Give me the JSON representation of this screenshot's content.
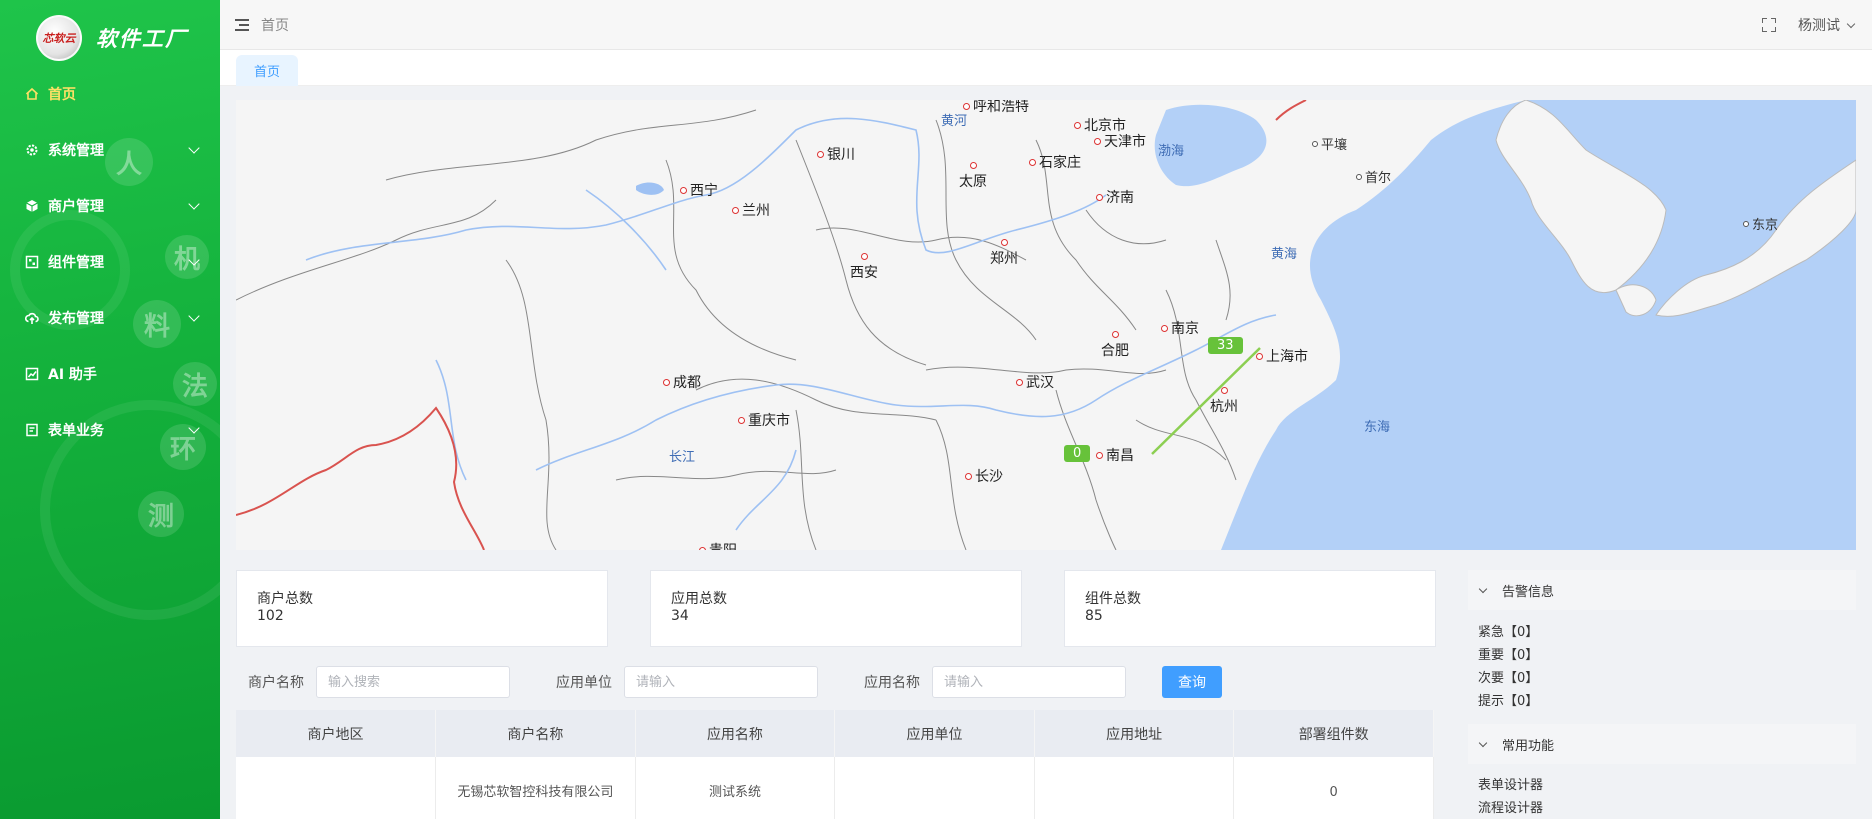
{
  "brand": {
    "name": "软件工厂",
    "logo_text": "芯软云"
  },
  "sidebar": {
    "items": [
      {
        "label": "首页",
        "icon": "home-icon",
        "active": true
      },
      {
        "label": "系统管理",
        "icon": "gear-icon",
        "expandable": true
      },
      {
        "label": "商户管理",
        "icon": "cube-icon",
        "expandable": true
      },
      {
        "label": "组件管理",
        "icon": "component-icon",
        "expandable": true
      },
      {
        "label": "发布管理",
        "icon": "cloud-upload-icon",
        "expandable": true
      },
      {
        "label": "AI 助手",
        "icon": "chart-icon"
      },
      {
        "label": "表单业务",
        "icon": "form-icon",
        "expandable": true
      }
    ],
    "decor_chars": [
      "人",
      "机",
      "料",
      "法",
      "环",
      "测"
    ]
  },
  "header": {
    "breadcrumb": "首页",
    "user": "杨测试"
  },
  "tabs": [
    {
      "label": "首页",
      "active": true
    }
  ],
  "map": {
    "cities": [
      "呼和浩特",
      "北京市",
      "天津市",
      "银川",
      "石家庄",
      "太原",
      "西宁",
      "兰州",
      "济南",
      "西安",
      "郑州",
      "南京",
      "合肥",
      "上海市",
      "成都",
      "武汉",
      "重庆市",
      "杭州",
      "南昌",
      "长沙",
      "贵阳",
      "平壤",
      "首尔",
      "东京"
    ],
    "water_labels": [
      "黄河",
      "渤海",
      "黄海",
      "东海",
      "长江"
    ],
    "markers": [
      {
        "label": "33"
      },
      {
        "label": "0"
      }
    ],
    "colors": {
      "land": "#f5f5f5",
      "sea": "#b3d0f7",
      "route": "#8ccf52",
      "marker": "#67c23a"
    }
  },
  "stats": [
    {
      "label": "商户总数",
      "value": "102"
    },
    {
      "label": "应用总数",
      "value": "34"
    },
    {
      "label": "组件总数",
      "value": "85"
    }
  ],
  "filter": {
    "merchant_label": "商户名称",
    "merchant_placeholder": "输入搜索",
    "unit_label": "应用单位",
    "unit_placeholder": "请输入",
    "app_label": "应用名称",
    "app_placeholder": "请输入",
    "query_button": "查询"
  },
  "table": {
    "columns": [
      "商户地区",
      "商户名称",
      "应用名称",
      "应用单位",
      "应用地址",
      "部署组件数"
    ],
    "rows": [
      [
        "",
        "无锡芯软智控科技有限公司",
        "测试系统",
        "",
        "",
        "0"
      ]
    ]
  },
  "alerts": {
    "title": "告警信息",
    "items": [
      "紧急【0】",
      "重要【0】",
      "次要【0】",
      "提示【0】"
    ]
  },
  "common": {
    "title": "常用功能",
    "items": [
      "表单设计器",
      "流程设计器"
    ]
  },
  "colors": {
    "sidebar": "#14b13c",
    "primary": "#409eff",
    "active_menu": "#ffe066"
  }
}
